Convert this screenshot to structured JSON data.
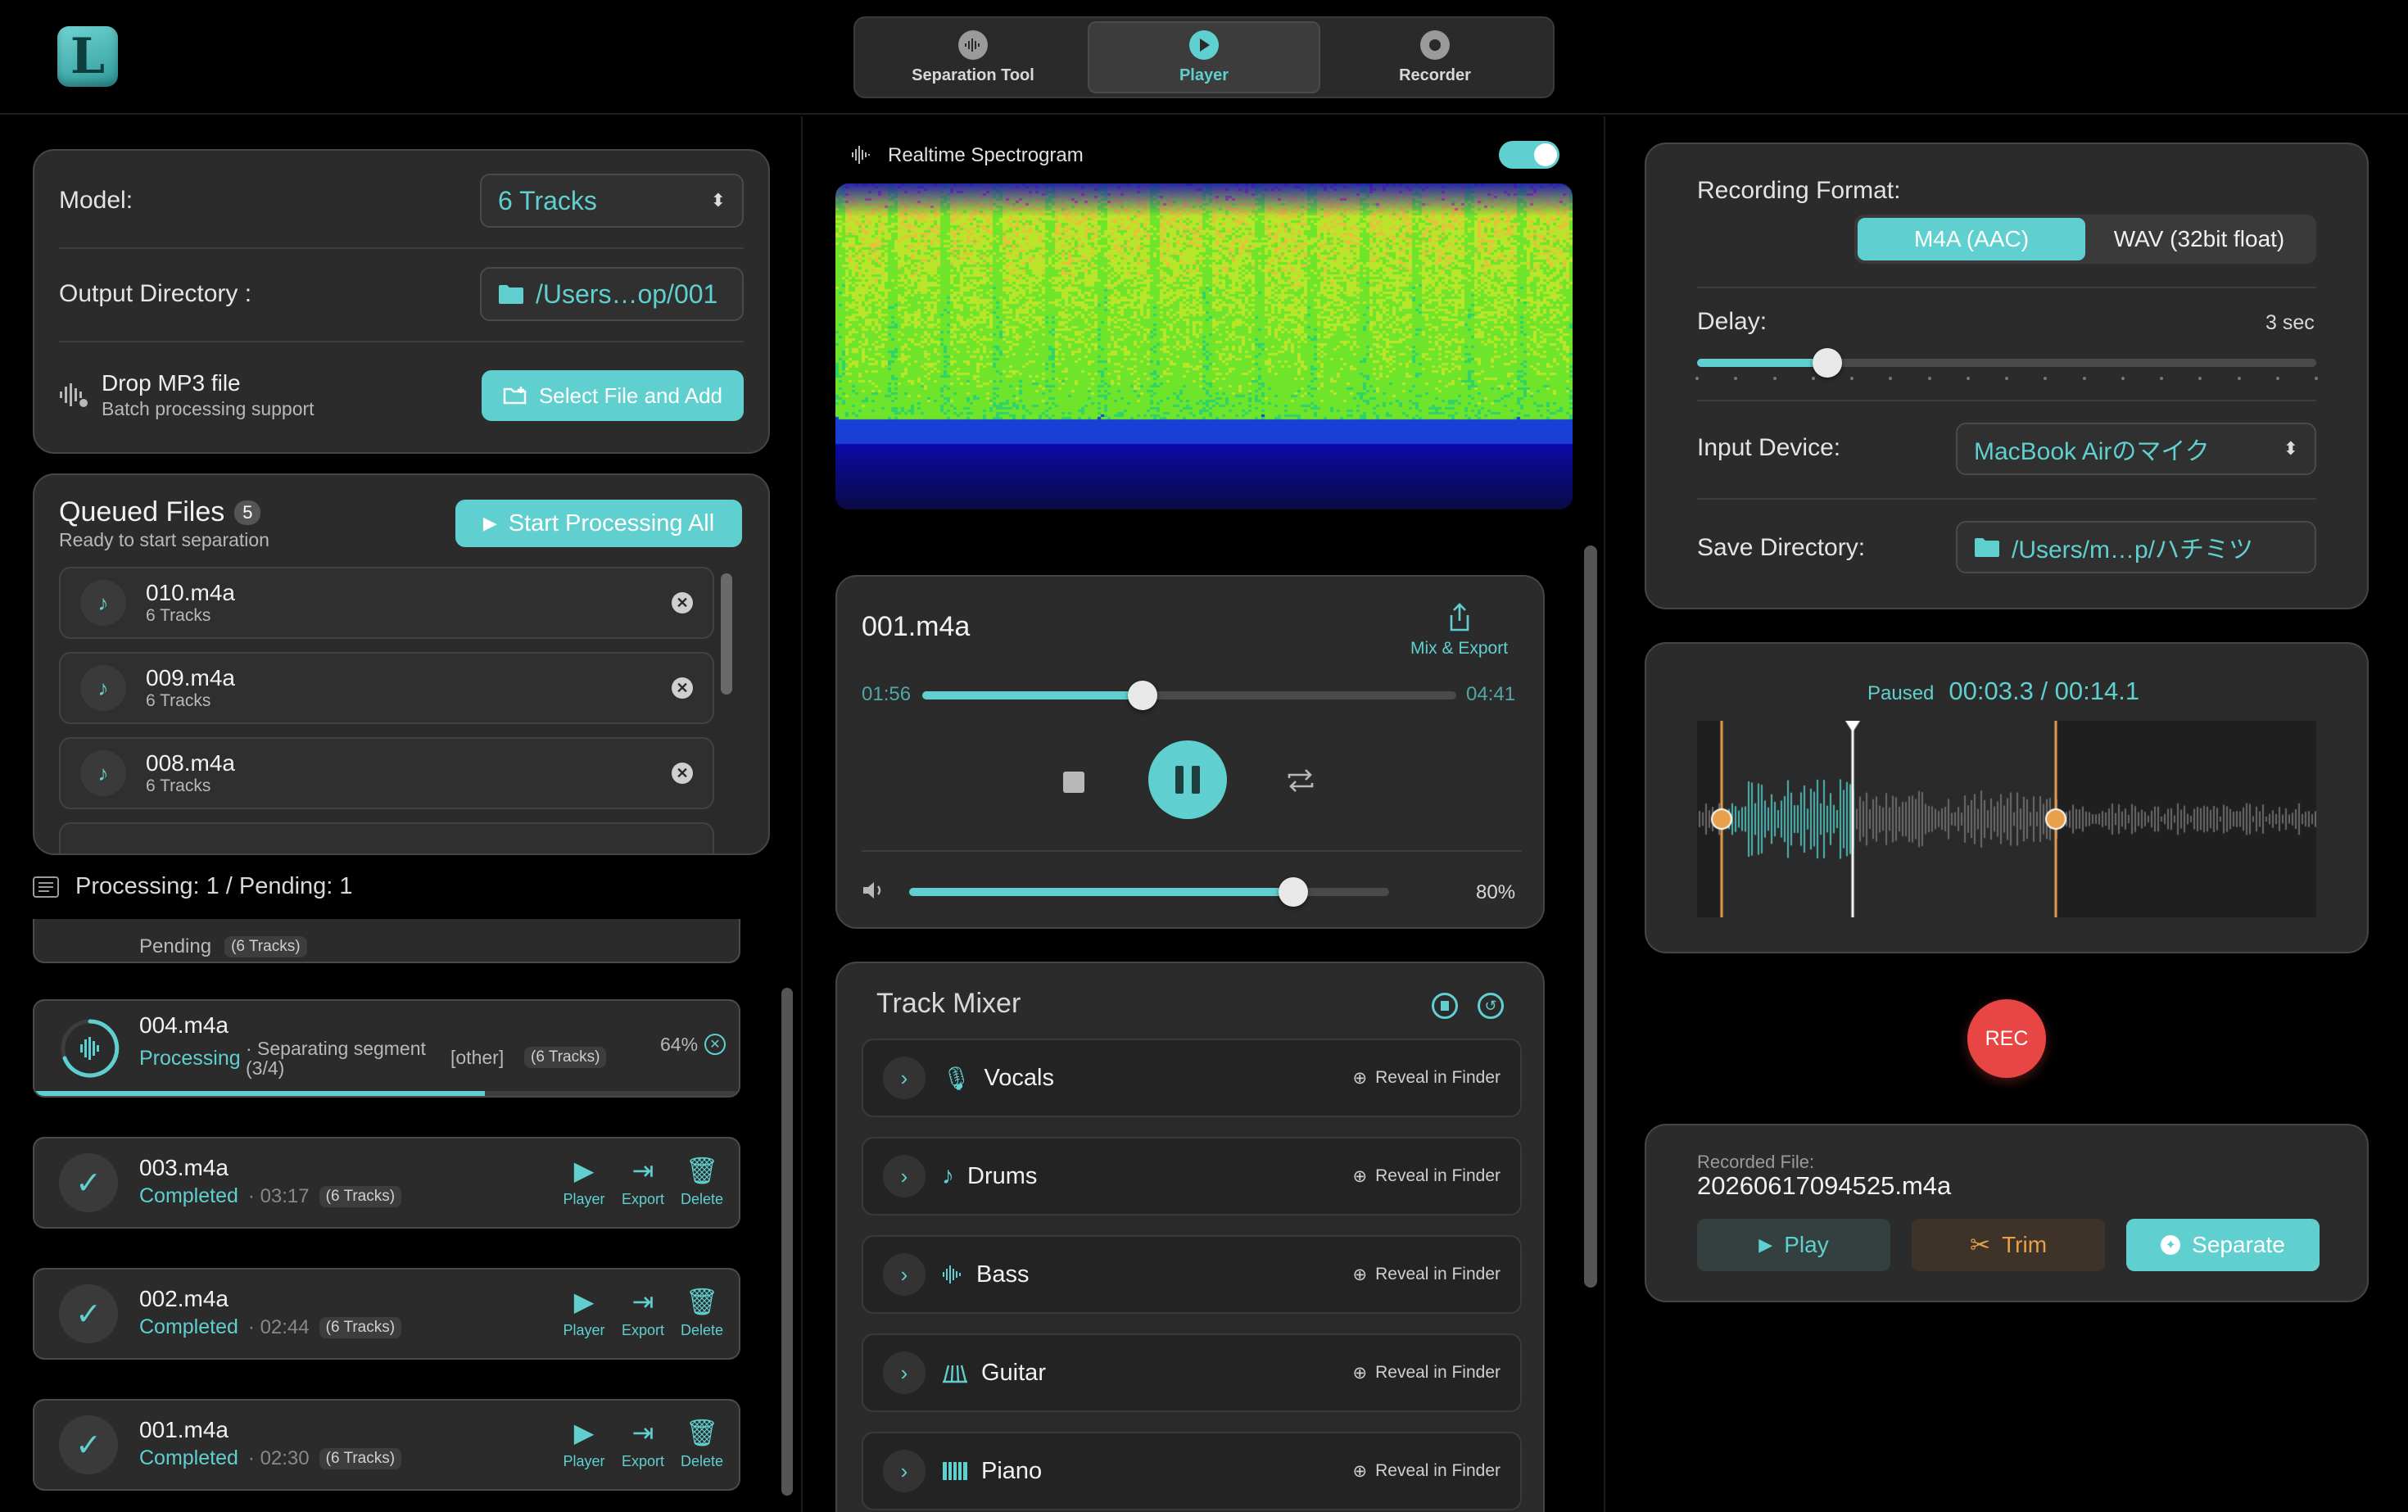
{
  "app": {
    "logo_letter": "L"
  },
  "modes": [
    {
      "label": "Separation Tool",
      "icon": "waveform-icon",
      "active": false
    },
    {
      "label": "Player",
      "icon": "play-icon",
      "active": true
    },
    {
      "label": "Recorder",
      "icon": "record-icon",
      "active": false
    }
  ],
  "settings": {
    "model_label": "Model:",
    "model_value": "6 Tracks",
    "output_label": "Output Directory :",
    "output_value": "/Users…op/001",
    "drop_title": "Drop MP3 file",
    "drop_sub": "Batch processing support",
    "select_button": "Select File and Add"
  },
  "queue": {
    "title": "Queued Files",
    "count": "5",
    "subtitle": "Ready to start separation",
    "start_button": "Start Processing All",
    "items": [
      {
        "name": "010.m4a",
        "tracks": "6 Tracks"
      },
      {
        "name": "009.m4a",
        "tracks": "6 Tracks"
      },
      {
        "name": "008.m4a",
        "tracks": "6 Tracks"
      }
    ]
  },
  "processing": {
    "summary": "Processing: 1 / Pending: 1",
    "pending_status": "Pending",
    "pending_tracks": "(6 Tracks)",
    "current": {
      "name": "004.m4a",
      "status": "Processing",
      "detail": "· Separating segment (3/4)",
      "stem": "[other]",
      "tracks": "(6 Tracks)",
      "percent": "64%",
      "progress": 0.64
    },
    "completed": [
      {
        "name": "003.m4a",
        "status": "Completed",
        "duration": "· 03:17",
        "tracks": "(6 Tracks)"
      },
      {
        "name": "002.m4a",
        "status": "Completed",
        "duration": "· 02:44",
        "tracks": "(6 Tracks)"
      },
      {
        "name": "001.m4a",
        "status": "Completed",
        "duration": "· 02:30",
        "tracks": "(6 Tracks)"
      }
    ],
    "actions": {
      "player": "Player",
      "export": "Export",
      "delete": "Delete"
    }
  },
  "spectrogram": {
    "title": "Realtime Spectrogram",
    "enabled": true
  },
  "player": {
    "file": "001.m4a",
    "export_label": "Mix & Export",
    "elapsed": "01:56",
    "total": "04:41",
    "position": 0.413,
    "volume_label": "80%",
    "volume": 0.8
  },
  "mixer": {
    "title": "Track Mixer",
    "reveal_label": "Reveal in Finder",
    "tracks": [
      {
        "name": "Vocals",
        "icon": "microphone-icon"
      },
      {
        "name": "Drums",
        "icon": "note-icon"
      },
      {
        "name": "Bass",
        "icon": "waveform-icon"
      },
      {
        "name": "Guitar",
        "icon": "guitar-icon"
      },
      {
        "name": "Piano",
        "icon": "piano-icon"
      }
    ]
  },
  "recorder": {
    "format_label": "Recording Format:",
    "format_options": [
      "M4A (AAC)",
      "WAV (32bit float)"
    ],
    "format_selected": "M4A (AAC)",
    "delay_label": "Delay:",
    "delay_value": "3 sec",
    "delay_level": 0.21,
    "input_label": "Input Device:",
    "input_value": "MacBook Airのマイク",
    "save_label": "Save Directory:",
    "save_value": "/Users/m…p/ハチミツ",
    "wave_status": "Paused",
    "wave_time": "00:03.3 / 00:14.1",
    "rec_label": "REC",
    "recorded_label": "Recorded File:",
    "recorded_file": "20260617094525.m4a",
    "play_button": "Play",
    "trim_button": "Trim",
    "separate_button": "Separate"
  },
  "colors": {
    "accent": "#5fd0cf",
    "rec": "#e84545",
    "trim": "#e8a04a"
  }
}
